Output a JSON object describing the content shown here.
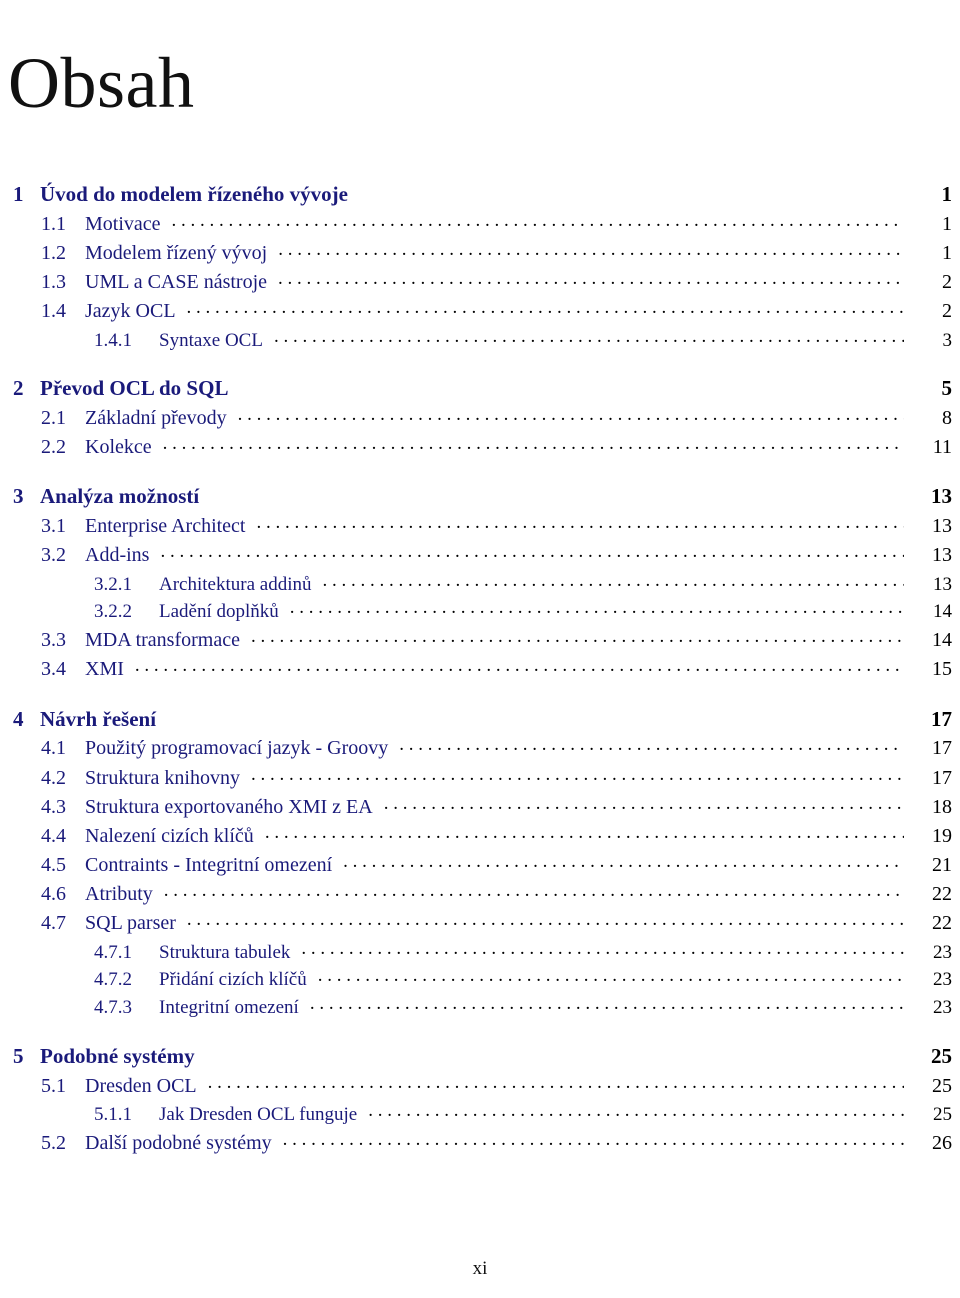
{
  "document": {
    "title": "Obsah",
    "folio": "xi",
    "text_color_entries": "#1a1a7a",
    "text_color_pagenumbers": "#000000",
    "background": "#ffffff"
  },
  "toc": {
    "entries": [
      {
        "level": "chapter",
        "number": "1",
        "title": "Úvod do modelem řízeného vývoje",
        "page": "1"
      },
      {
        "level": "section",
        "number": "1.1",
        "title": "Motivace",
        "page": "1"
      },
      {
        "level": "section",
        "number": "1.2",
        "title": "Modelem řízený vývoj",
        "page": "1"
      },
      {
        "level": "section",
        "number": "1.3",
        "title": "UML a CASE nástroje",
        "page": "2"
      },
      {
        "level": "section",
        "number": "1.4",
        "title": "Jazyk OCL",
        "page": "2"
      },
      {
        "level": "subsection",
        "number": "1.4.1",
        "title": "Syntaxe OCL",
        "page": "3"
      },
      {
        "level": "chapter",
        "number": "2",
        "title": "Převod OCL do SQL",
        "page": "5"
      },
      {
        "level": "section",
        "number": "2.1",
        "title": "Základní převody",
        "page": "8"
      },
      {
        "level": "section",
        "number": "2.2",
        "title": "Kolekce",
        "page": "11"
      },
      {
        "level": "chapter",
        "number": "3",
        "title": "Analýza možností",
        "page": "13"
      },
      {
        "level": "section",
        "number": "3.1",
        "title": "Enterprise Architect",
        "page": "13"
      },
      {
        "level": "section",
        "number": "3.2",
        "title": "Add-ins",
        "page": "13"
      },
      {
        "level": "subsection",
        "number": "3.2.1",
        "title": "Architektura addinů",
        "page": "13"
      },
      {
        "level": "subsection",
        "number": "3.2.2",
        "title": "Ladění doplňků",
        "page": "14"
      },
      {
        "level": "section",
        "number": "3.3",
        "title": "MDA transformace",
        "page": "14"
      },
      {
        "level": "section",
        "number": "3.4",
        "title": "XMI",
        "page": "15"
      },
      {
        "level": "chapter",
        "number": "4",
        "title": "Návrh řešení",
        "page": "17"
      },
      {
        "level": "section",
        "number": "4.1",
        "title": "Použitý programovací jazyk - Groovy",
        "page": "17"
      },
      {
        "level": "section",
        "number": "4.2",
        "title": "Struktura knihovny",
        "page": "17"
      },
      {
        "level": "section",
        "number": "4.3",
        "title": "Struktura exportovaného XMI z EA",
        "page": "18"
      },
      {
        "level": "section",
        "number": "4.4",
        "title": "Nalezení cizích klíčů",
        "page": "19"
      },
      {
        "level": "section",
        "number": "4.5",
        "title": "Contraints - Integritní omezení",
        "page": "21"
      },
      {
        "level": "section",
        "number": "4.6",
        "title": "Atributy",
        "page": "22"
      },
      {
        "level": "section",
        "number": "4.7",
        "title": "SQL parser",
        "page": "22"
      },
      {
        "level": "subsection",
        "number": "4.7.1",
        "title": "Struktura tabulek",
        "page": "23"
      },
      {
        "level": "subsection",
        "number": "4.7.2",
        "title": "Přidání cizích klíčů",
        "page": "23"
      },
      {
        "level": "subsection",
        "number": "4.7.3",
        "title": "Integritní omezení",
        "page": "23"
      },
      {
        "level": "chapter",
        "number": "5",
        "title": "Podobné systémy",
        "page": "25"
      },
      {
        "level": "section",
        "number": "5.1",
        "title": "Dresden OCL",
        "page": "25"
      },
      {
        "level": "subsection",
        "number": "5.1.1",
        "title": "Jak Dresden OCL funguje",
        "page": "25"
      },
      {
        "level": "section",
        "number": "5.2",
        "title": "Další podobné systémy",
        "page": "26"
      }
    ]
  }
}
